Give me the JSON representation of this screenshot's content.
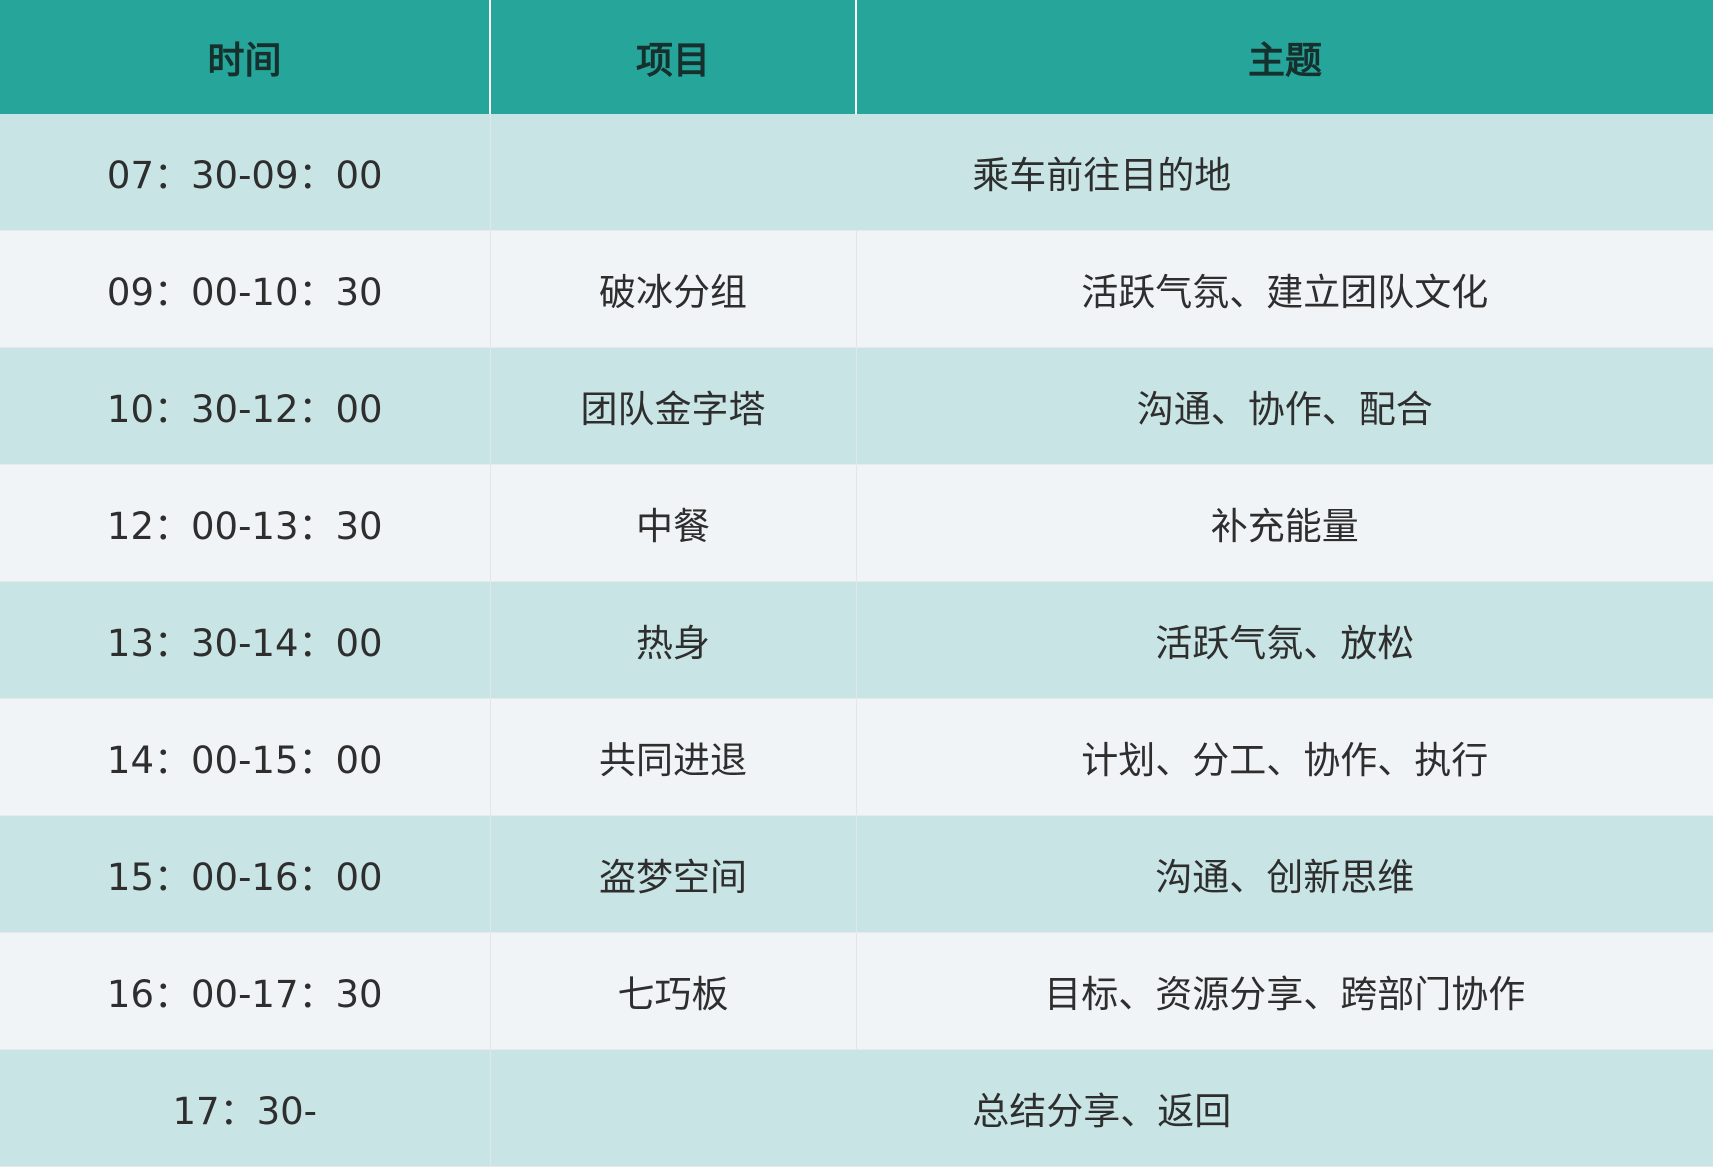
{
  "table": {
    "headers": [
      "时间",
      "项目",
      "主题"
    ],
    "rows": [
      {
        "time": "07：30-09：00",
        "merged": "乘车前往目的地"
      },
      {
        "time": "09：00-10：30",
        "item": "破冰分组",
        "topic": "活跃气氛、建立团队文化"
      },
      {
        "time": "10：30-12：00",
        "item": "团队金字塔",
        "topic": "沟通、协作、配合"
      },
      {
        "time": "12：00-13：30",
        "item": "中餐",
        "topic": "补充能量"
      },
      {
        "time": "13：30-14：00",
        "item": "热身",
        "topic": "活跃气氛、放松"
      },
      {
        "time": "14：00-15：00",
        "item": "共同进退",
        "topic": "计划、分工、协作、执行"
      },
      {
        "time": "15：00-16：00",
        "item": "盗梦空间",
        "topic": "沟通、创新思维"
      },
      {
        "time": "16：00-17：30",
        "item": "七巧板",
        "topic": "目标、资源分享、跨部门协作"
      },
      {
        "time": "17：30-",
        "merged": "总结分享、返回"
      }
    ]
  },
  "colors": {
    "header_bg": "#26a69a",
    "row_odd": "#c8e4e4",
    "row_even": "#f1f4f7"
  }
}
